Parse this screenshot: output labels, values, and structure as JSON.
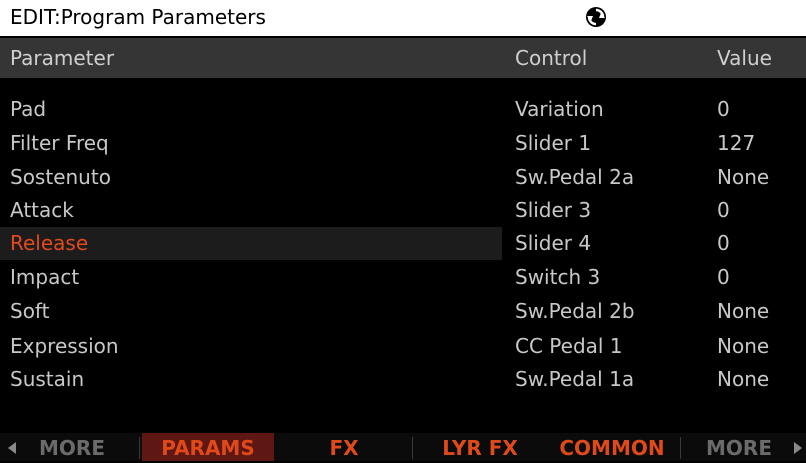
{
  "title": "EDIT:Program Parameters",
  "colors": {
    "selected_text": "#e24a1e",
    "accent": "#e04a1a"
  },
  "header": {
    "parameter": "Parameter",
    "control": "Control",
    "value": "Value"
  },
  "rows": [
    {
      "parameter": "Pad",
      "control": "Variation",
      "value": "0"
    },
    {
      "parameter": "Filter Freq",
      "control": "Slider 1",
      "value": "127"
    },
    {
      "parameter": "Sostenuto",
      "control": "Sw.Pedal 2a",
      "value": "None"
    },
    {
      "parameter": "Attack",
      "control": "Slider 3",
      "value": "0"
    },
    {
      "parameter": "Release",
      "control": "Slider 4",
      "value": "0"
    },
    {
      "parameter": "Impact",
      "control": "Switch 3",
      "value": "0"
    },
    {
      "parameter": "Soft",
      "control": "Sw.Pedal 2b",
      "value": "None"
    },
    {
      "parameter": "Expression",
      "control": "CC Pedal 1",
      "value": "None"
    },
    {
      "parameter": "Sustain",
      "control": "Sw.Pedal 1a",
      "value": "None"
    }
  ],
  "selected_row": "Release",
  "softkeys": [
    "MORE",
    "PARAMS",
    "FX",
    "LYR FX",
    "COMMON",
    "MORE"
  ],
  "active_softkey": "PARAMS"
}
